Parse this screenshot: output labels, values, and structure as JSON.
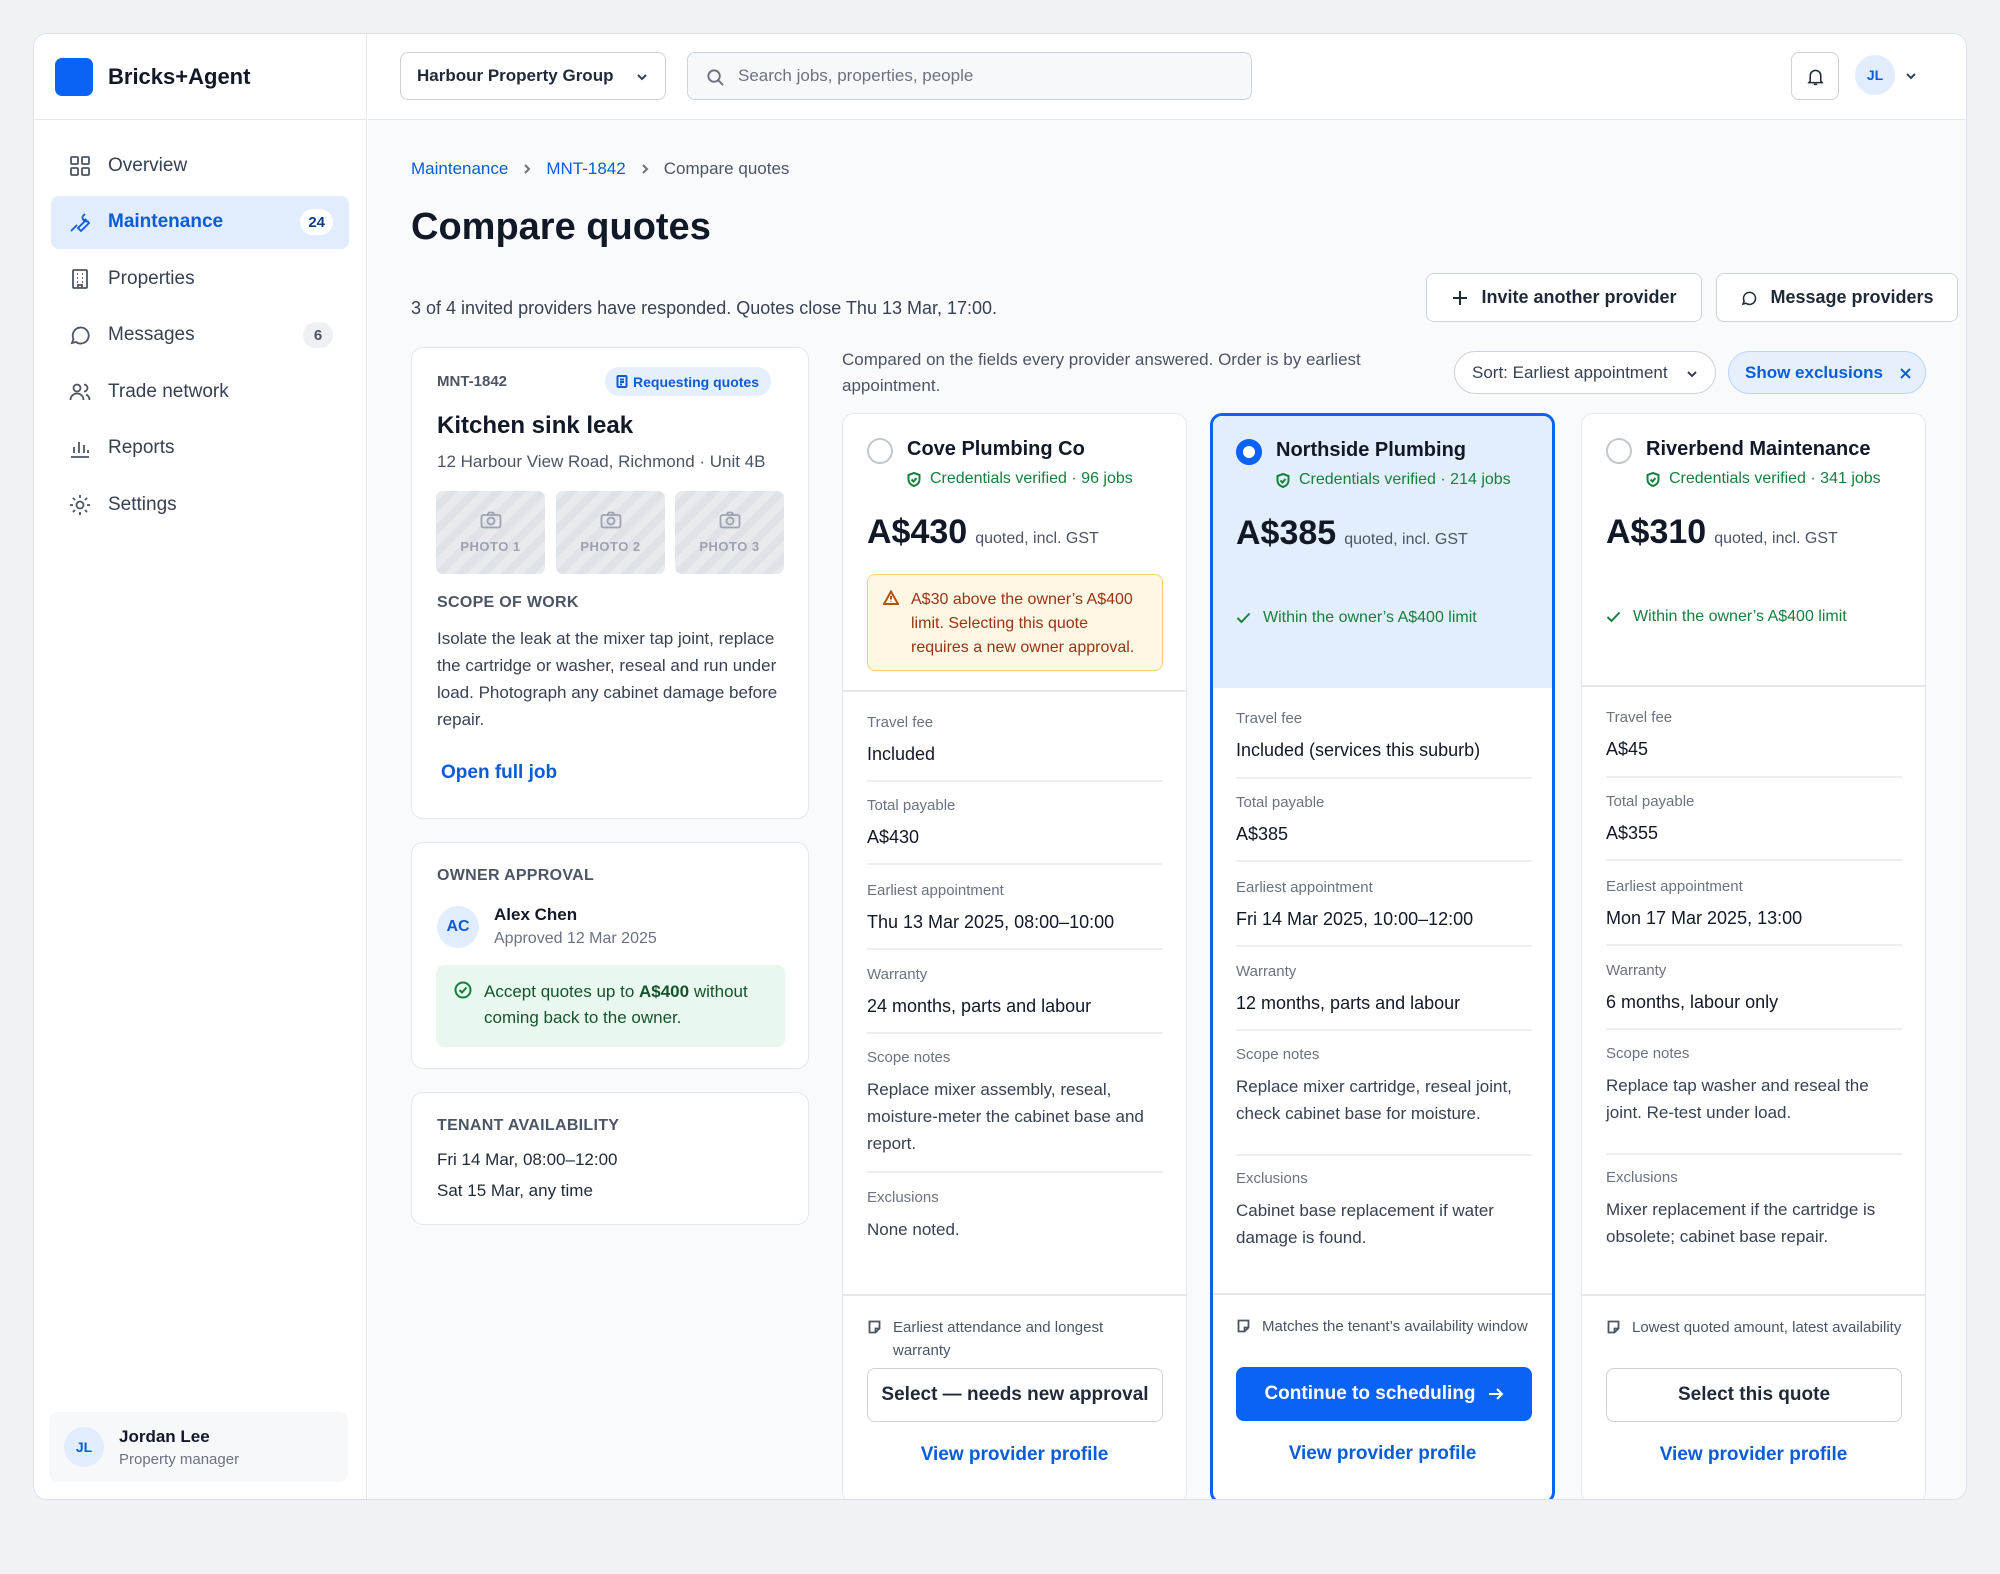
{
  "app": {
    "brand": "Bricks+Agent"
  },
  "sidebar": {
    "items": [
      {
        "label": "Overview",
        "icon": "grid-icon"
      },
      {
        "label": "Maintenance",
        "icon": "wrench-icon",
        "badge": "24",
        "active": true
      },
      {
        "label": "Properties",
        "icon": "building-icon"
      },
      {
        "label": "Messages",
        "icon": "chat-icon",
        "badge": "6"
      },
      {
        "label": "Trade network",
        "icon": "users-icon"
      },
      {
        "label": "Reports",
        "icon": "bar-chart-icon"
      },
      {
        "label": "Settings",
        "icon": "gear-icon"
      }
    ],
    "user": {
      "initials": "JL",
      "name": "Jordan Lee",
      "role": "Property manager"
    }
  },
  "topbar": {
    "org": "Harbour Property Group",
    "search_placeholder": "Search jobs, properties, people",
    "avatar": "JL"
  },
  "breadcrumb": {
    "items": [
      "Maintenance",
      "MNT-1842",
      "Compare quotes"
    ]
  },
  "page": {
    "title": "Compare quotes",
    "subtitle": "3 of 4 invited providers have responded. Quotes close Thu 13 Mar, 17:00.",
    "invite_label": "Invite another provider",
    "message_label": "Message providers"
  },
  "job": {
    "id": "MNT-1842",
    "status": "Requesting quotes",
    "title": "Kitchen sink leak",
    "address": "12 Harbour View Road, Richmond · Unit 4B",
    "photos": [
      "PHOTO 1",
      "PHOTO 2",
      "PHOTO 3"
    ],
    "scope_label": "SCOPE OF WORK",
    "scope_text": "Isolate the leak at the mixer tap joint, replace the cartridge or washer, reseal and run under load. Photograph any cabinet damage before repair.",
    "open_label": "Open full job"
  },
  "owner_approval": {
    "label": "OWNER APPROVAL",
    "initials": "AC",
    "name": "Alex Chen",
    "date": "Approved 12 Mar 2025",
    "text_pre": "Accept quotes up to ",
    "limit": "A$400",
    "text_post": " without coming back to the owner."
  },
  "tenant": {
    "label": "TENANT AVAILABILITY",
    "slots": [
      "Fri 14 Mar, 08:00–12:00",
      "Sat 15 Mar, any time"
    ]
  },
  "compare": {
    "note": "Compared on the fields every provider answered. Order is by earliest appointment.",
    "sort_label": "Sort: Earliest appointment",
    "exclusions_label": "Show exclusions"
  },
  "field_labels": {
    "travel": "Travel fee",
    "total": "Total payable",
    "appt": "Earliest appointment",
    "warranty": "Warranty",
    "scope": "Scope notes",
    "exclusions": "Exclusions"
  },
  "quotes": [
    {
      "name": "Cove Plumbing Co",
      "credentials": "Credentials verified · 96 jobs",
      "price": "A$430",
      "price_sub": "quoted, incl. GST",
      "warning": "A$30 above the owner’s A$400 limit. Selecting this quote requires a new owner approval.",
      "travel": "Included",
      "total": "A$430",
      "appt": "Thu 13 Mar 2025, 08:00–10:00",
      "warranty": "24 months, parts and labour",
      "scope": "Replace mixer assembly, reseal, moisture-meter the cabinet base and report.",
      "exclusions": "None noted.",
      "reason": "Earliest attendance and longest warranty",
      "button": "Select — needs new approval",
      "profile": "View provider profile"
    },
    {
      "name": "Northside Plumbing",
      "credentials": "Credentials verified · 214 jobs",
      "price": "A$385",
      "price_sub": "quoted, incl. GST",
      "within": "Within the owner’s A$400 limit",
      "travel": "Included (services this suburb)",
      "total": "A$385",
      "appt": "Fri 14 Mar 2025, 10:00–12:00",
      "warranty": "12 months, parts and labour",
      "scope": "Replace mixer cartridge, reseal joint, check cabinet base for moisture.",
      "exclusions": "Cabinet base replacement if water damage is found.",
      "reason": "Matches the tenant’s availability window",
      "button": "Continue to scheduling",
      "profile": "View provider profile"
    },
    {
      "name": "Riverbend Maintenance",
      "credentials": "Credentials verified · 341 jobs",
      "price": "A$310",
      "price_sub": "quoted, incl. GST",
      "within": "Within the owner’s A$400 limit",
      "travel": "A$45",
      "total": "A$355",
      "appt": "Mon 17 Mar 2025, 13:00",
      "warranty": "6 months, labour only",
      "scope": "Replace tap washer and reseal the joint. Re-test under load.",
      "exclusions": "Mixer replacement if the cartridge is obsolete; cabinet base repair.",
      "reason": "Lowest quoted amount, latest availability",
      "button": "Select this quote",
      "profile": "View provider profile"
    }
  ],
  "colors": {
    "accent": "#0b63f6",
    "success": "#15803d",
    "warning_bg": "#fdf7e3"
  }
}
